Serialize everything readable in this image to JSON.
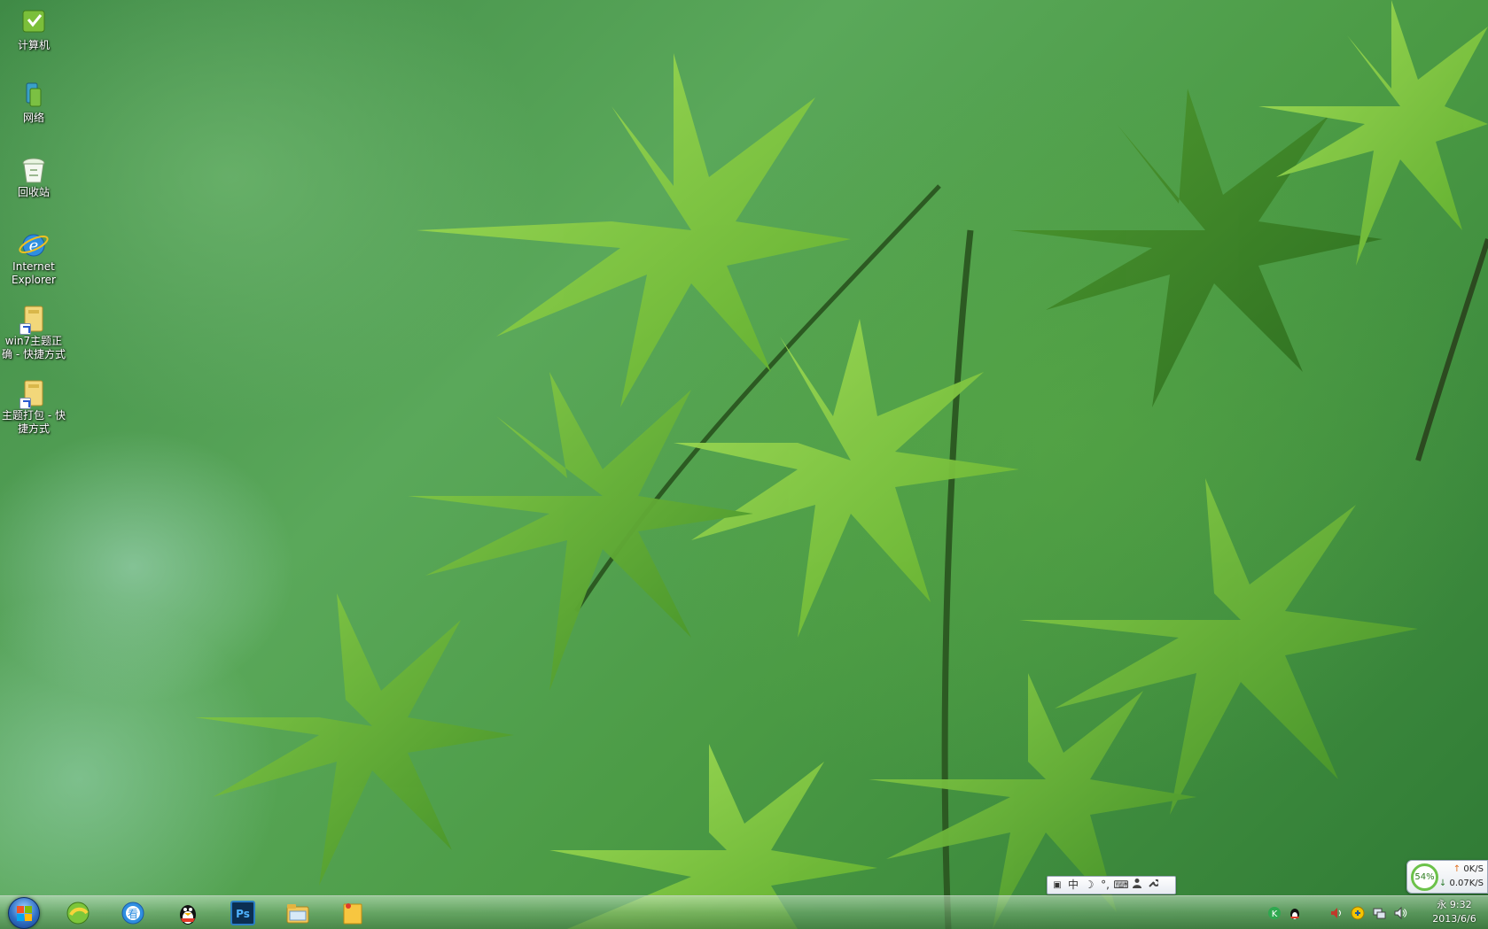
{
  "desktop": {
    "icons": [
      {
        "label": "计算机",
        "icon": "computer-icon"
      },
      {
        "label": "网络",
        "icon": "network-icon"
      },
      {
        "label": "回收站",
        "icon": "recycle-bin-icon"
      },
      {
        "label": "Internet Explorer",
        "icon": "ie-icon"
      },
      {
        "label": "win7主题正确 - 快捷方式",
        "icon": "folder-shortcut-icon"
      },
      {
        "label": "主题打包 - 快捷方式",
        "icon": "folder-shortcut-icon"
      }
    ]
  },
  "ime": {
    "buttons": [
      "中",
      "☽",
      "°,",
      "⌨",
      "👤",
      "🔧"
    ],
    "mode_label": "中"
  },
  "network_widget": {
    "percent": "54%",
    "upload": "0K/S",
    "download": "0.07K/S"
  },
  "taskbar": {
    "pinned": [
      {
        "name": "360-browser",
        "icon": "360-browser-icon"
      },
      {
        "name": "kankan",
        "icon": "kankan-player-icon"
      },
      {
        "name": "qq",
        "icon": "qq-penguin-icon"
      },
      {
        "name": "photoshop",
        "icon": "photoshop-icon",
        "text": "Ps"
      },
      {
        "name": "explorer",
        "icon": "file-explorer-icon"
      },
      {
        "name": "sticky-notes",
        "icon": "sticky-notes-icon"
      }
    ],
    "tray": [
      "kaspersky-icon",
      "qq-tray-icon",
      "volume-icon",
      "security-icon",
      "network-tray-icon",
      "speaker-icon"
    ],
    "clock": {
      "day_time": "永 9:32",
      "date": "2013/6/6"
    }
  },
  "colors": {
    "accent": "#2f6fc4",
    "leaf": "#7cc93a",
    "taskbar": "#6fa36b"
  }
}
